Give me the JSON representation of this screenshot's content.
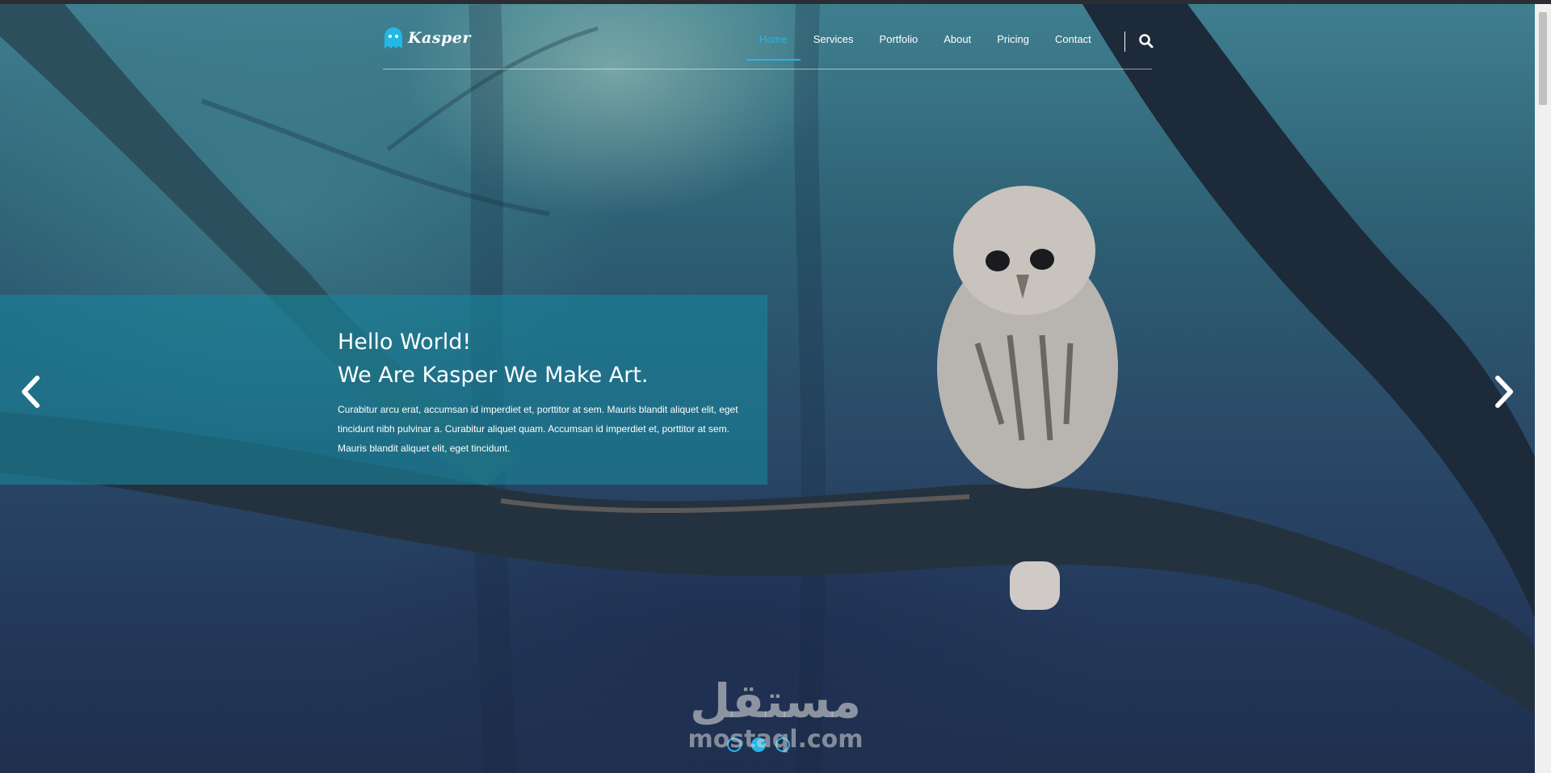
{
  "brand": {
    "name": "Kasper",
    "accent": "#23b7e5"
  },
  "nav": {
    "items": [
      {
        "label": "Home",
        "active": true
      },
      {
        "label": "Services",
        "active": false
      },
      {
        "label": "Portfolio",
        "active": false
      },
      {
        "label": "About",
        "active": false
      },
      {
        "label": "Pricing",
        "active": false
      },
      {
        "label": "Contact",
        "active": false
      }
    ],
    "search_icon": "search-icon"
  },
  "hero": {
    "title_line1": "Hello World!",
    "title_line2": "We Are Kasper We Make Art.",
    "description": "Curabitur arcu erat, accumsan id imperdiet et, porttitor at sem. Mauris blandit aliquet elit, eget tincidunt nibh pulvinar a. Curabitur aliquet quam. Accumsan id imperdiet et, porttitor at sem. Mauris blandit aliquet elit, eget tincidunt.",
    "prev_icon": "chevron-left-icon",
    "next_icon": "chevron-right-icon",
    "slides_total": 3,
    "active_slide": 2
  },
  "watermark": {
    "arabic": "مستقل",
    "latin": "mostaql.com"
  }
}
